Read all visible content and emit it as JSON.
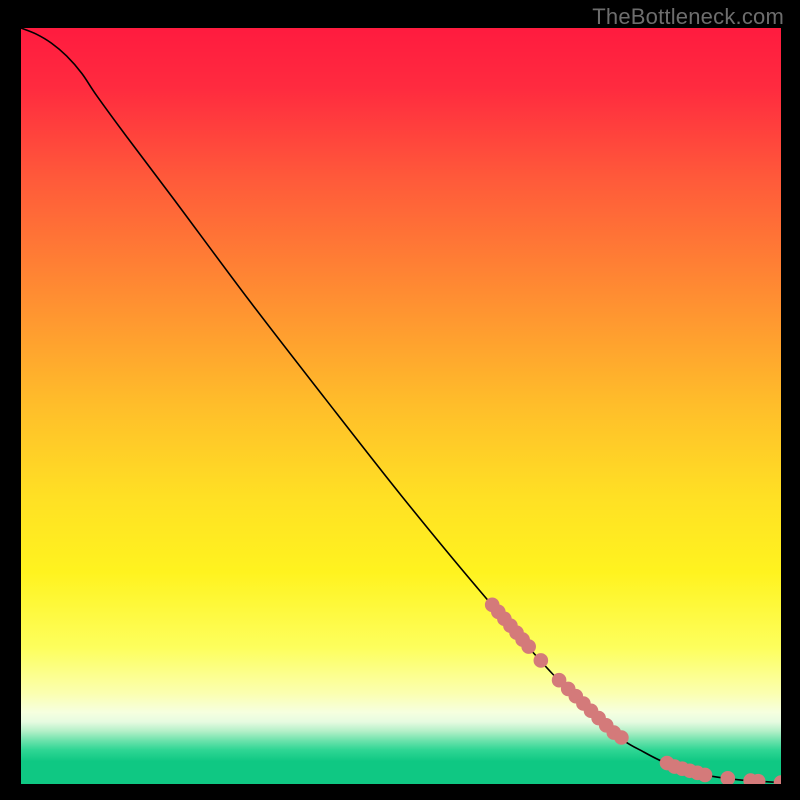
{
  "watermark": "TheBottleneck.com",
  "colors": {
    "frame": "#000000",
    "watermark": "#6d6d6d",
    "curve": "#000000",
    "dot_fill": "#d47a7a",
    "dot_stroke": "#b75454",
    "gradient_stops": [
      {
        "offset": 0.0,
        "color": "#ff1b3f"
      },
      {
        "offset": 0.08,
        "color": "#ff2b3f"
      },
      {
        "offset": 0.2,
        "color": "#ff5a3a"
      },
      {
        "offset": 0.35,
        "color": "#ff8c32"
      },
      {
        "offset": 0.5,
        "color": "#ffbe2a"
      },
      {
        "offset": 0.62,
        "color": "#ffe024"
      },
      {
        "offset": 0.72,
        "color": "#fff31f"
      },
      {
        "offset": 0.82,
        "color": "#fdff5d"
      },
      {
        "offset": 0.88,
        "color": "#fbffb0"
      },
      {
        "offset": 0.905,
        "color": "#f6ffdf"
      },
      {
        "offset": 0.918,
        "color": "#e6fbe0"
      },
      {
        "offset": 0.93,
        "color": "#b4f0c8"
      },
      {
        "offset": 0.942,
        "color": "#6fe3ad"
      },
      {
        "offset": 0.955,
        "color": "#2fd694"
      },
      {
        "offset": 0.97,
        "color": "#0fc883"
      },
      {
        "offset": 1.0,
        "color": "#0fc883"
      }
    ]
  },
  "chart_data": {
    "type": "line",
    "title": "",
    "xlabel": "",
    "ylabel": "",
    "xlim": [
      0,
      100
    ],
    "ylim": [
      0,
      100
    ],
    "series": [
      {
        "name": "curve",
        "x": [
          0,
          2,
          4,
          6,
          8,
          10,
          14,
          20,
          30,
          40,
          50,
          60,
          70,
          78,
          82,
          86,
          90,
          94,
          98,
          100
        ],
        "y": [
          100,
          99.2,
          98.0,
          96.3,
          94.0,
          91.0,
          85.5,
          77.5,
          64.0,
          51.0,
          38.2,
          26.0,
          14.5,
          6.8,
          4.2,
          2.3,
          1.2,
          0.6,
          0.3,
          0.2
        ]
      }
    ],
    "scatter_on_curve": {
      "name": "markers",
      "x": [
        62.0,
        62.8,
        63.6,
        64.4,
        65.2,
        66.0,
        66.8,
        68.4,
        70.8,
        72.0,
        73.0,
        74.0,
        75.0,
        76.0,
        77.0,
        78.0,
        79.0,
        85.0,
        86.0,
        87.0,
        88.0,
        89.0,
        90.0,
        93.0,
        96.0,
        97.0,
        100.0
      ]
    }
  }
}
